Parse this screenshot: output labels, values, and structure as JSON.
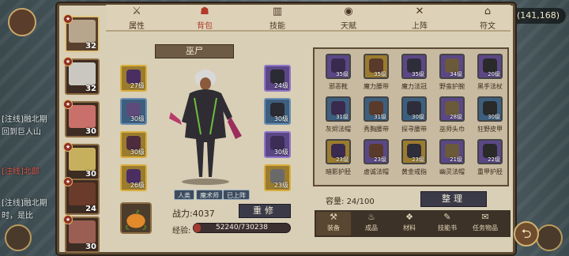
{
  "currency": {
    "value": "(141,168)"
  },
  "chat": [
    {
      "text": "[注线]融北期",
      "color": "#dfe6e8"
    },
    {
      "text": "回到巨人山",
      "color": "#dfe6e8"
    },
    {
      "text": "[注线]北部",
      "color": "#e05b4d"
    },
    {
      "text": "[注线]融北期",
      "color": "#dfe6e8"
    },
    {
      "text": "时，是比",
      "color": "#dfe6e8"
    },
    {
      "text": "[注线]融北期",
      "color": "#dfe6e8"
    },
    {
      "text": "[注线]北部",
      "color": "#e05b4d"
    }
  ],
  "heroes": [
    {
      "level": "32",
      "face": "#b7a58c"
    },
    {
      "level": "32",
      "face": "#c9c7c0"
    },
    {
      "level": "30",
      "face": "#c87069"
    },
    {
      "level": "30",
      "face": "#c6b05d"
    },
    {
      "level": "24",
      "face": "#6a3b2a"
    },
    {
      "level": "30",
      "face": "#9a5f52"
    }
  ],
  "tabs": [
    {
      "label": "属性",
      "icon": "sword-shield-icon",
      "glyph": "⚔"
    },
    {
      "label": "背包",
      "icon": "bag-icon",
      "glyph": "☗"
    },
    {
      "label": "技能",
      "icon": "book-icon",
      "glyph": "▥"
    },
    {
      "label": "天赋",
      "icon": "eye-icon",
      "glyph": "◉"
    },
    {
      "label": "上阵",
      "icon": "crossed-swords-icon",
      "glyph": "✕"
    },
    {
      "label": "符文",
      "icon": "rune-icon",
      "glyph": "⌂"
    }
  ],
  "character": {
    "name": "巫尸",
    "power_label": "战力:4037",
    "exp_label": "经验:",
    "exp_text": "52240/730238",
    "exp_fraction": 0.07
  },
  "stat_badges": [
    "人类",
    "魔术师",
    "已上阵"
  ],
  "equip_left": [
    {
      "level": "27级",
      "quality": "gold"
    },
    {
      "level": "30级",
      "quality": "blue"
    },
    {
      "level": "30级",
      "quality": "gold"
    },
    {
      "level": "26级",
      "quality": "gold"
    }
  ],
  "equip_right": [
    {
      "level": "24级",
      "quality": "purple"
    },
    {
      "level": "30级",
      "quality": "blue"
    },
    {
      "level": "30级",
      "quality": "purple"
    },
    {
      "level": "23级",
      "quality": "gold"
    }
  ],
  "rebuild_label": "重修",
  "bag_items": [
    {
      "name": "邪恶靴",
      "level": "35级",
      "quality": "purple"
    },
    {
      "name": "魔力腰带",
      "level": "35级",
      "quality": "gold"
    },
    {
      "name": "魔力法冠",
      "level": "35级",
      "quality": "purple"
    },
    {
      "name": "野蛮护腕",
      "level": "34级",
      "quality": "purple"
    },
    {
      "name": "黑手法杖",
      "level": "20级",
      "quality": "purple"
    },
    {
      "name": "灰烬法帽",
      "level": "31级",
      "quality": "blue"
    },
    {
      "name": "秀胸腰带",
      "level": "31级",
      "quality": "blue"
    },
    {
      "name": "探寻腰带",
      "level": "30级",
      "quality": "blue"
    },
    {
      "name": "巫师头巾",
      "level": "28级",
      "quality": "purple"
    },
    {
      "name": "狂野皮甲",
      "level": "30级",
      "quality": "blue"
    },
    {
      "name": "暗影护胫",
      "level": "23级",
      "quality": "gold"
    },
    {
      "name": "虚诚法帽",
      "level": "23级",
      "quality": "purple"
    },
    {
      "name": "黄金戒指",
      "level": "23级",
      "quality": "gold"
    },
    {
      "name": "幽灵法帽",
      "level": "21级",
      "quality": "purple"
    },
    {
      "name": "重甲护胫",
      "level": "22级",
      "quality": "purple"
    }
  ],
  "capacity_label": "容量:",
  "capacity_value": "24/100",
  "organize_label": "整理",
  "bag_tabs": [
    {
      "label": "装备",
      "icon": "hammer-icon",
      "glyph": "⚒"
    },
    {
      "label": "成品",
      "icon": "potion-icon",
      "glyph": "♨"
    },
    {
      "label": "材料",
      "icon": "material-icon",
      "glyph": "❖"
    },
    {
      "label": "技能书",
      "icon": "scroll-icon",
      "glyph": "✎"
    },
    {
      "label": "任务物品",
      "icon": "quest-icon",
      "glyph": "✉"
    }
  ],
  "colors": {
    "gold": "#9b7c2e",
    "purple": "#5b4786",
    "blue": "#3d5f7f",
    "accent_red": "#b13a2a"
  }
}
